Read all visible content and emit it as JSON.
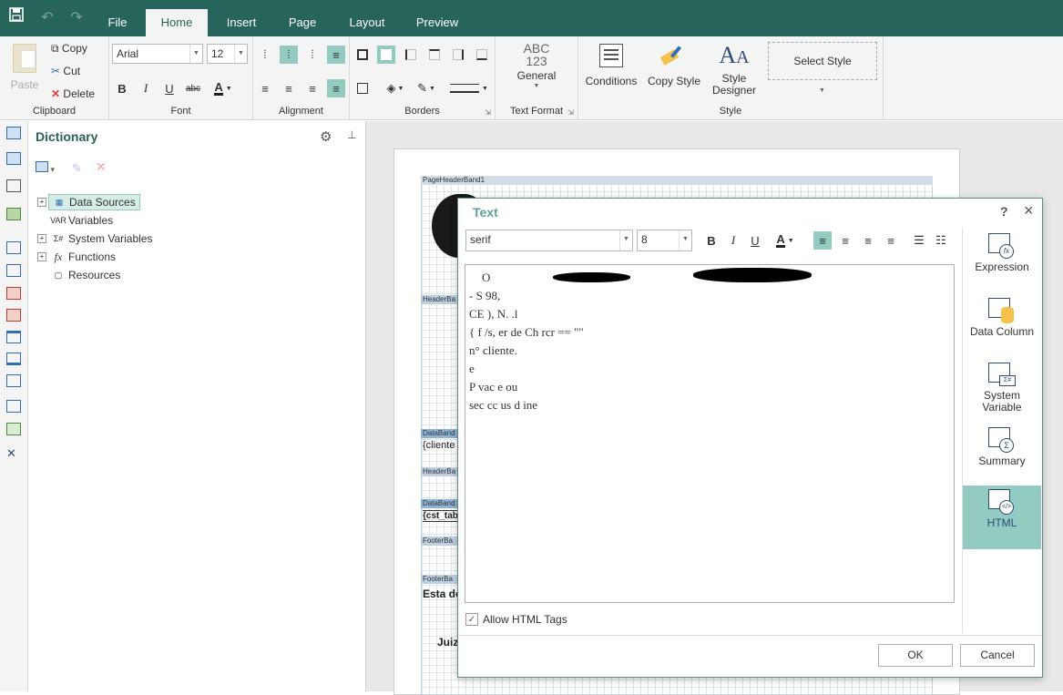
{
  "tabs": [
    "File",
    "Home",
    "Insert",
    "Page",
    "Layout",
    "Preview"
  ],
  "active_tab": "Home",
  "clipboard": {
    "paste": "Paste",
    "copy": "Copy",
    "cut": "Cut",
    "delete": "Delete",
    "label": "Clipboard"
  },
  "font": {
    "family": "Arial",
    "size": "12",
    "label": "Font",
    "bold": "B",
    "italic": "I",
    "underline": "U",
    "strike": "abc",
    "color": "A"
  },
  "alignment": {
    "label": "Alignment"
  },
  "borders": {
    "label": "Borders"
  },
  "text_format": {
    "abc": "ABC",
    "num": "123",
    "general": "General",
    "label": "Text Format"
  },
  "style": {
    "conditions": "Conditions",
    "copy_style": "Copy Style",
    "style_designer": "Style Designer",
    "select_style": "Select Style",
    "label": "Style"
  },
  "dictionary": {
    "title": "Dictionary",
    "items": [
      {
        "label": "Data Sources",
        "expandable": true,
        "selected": true
      },
      {
        "label": "Variables",
        "expandable": false
      },
      {
        "label": "System Variables",
        "expandable": true
      },
      {
        "label": "Functions",
        "expandable": true
      },
      {
        "label": "Resources",
        "expandable": false
      }
    ]
  },
  "report": {
    "bands": [
      {
        "label": "PageHeaderBand1",
        "wide": true
      },
      {
        "label": "HeaderBa"
      },
      {
        "label": "DataBand"
      },
      {
        "label": "HeaderBa"
      },
      {
        "label": "DataBand"
      },
      {
        "label": "FooterBa"
      },
      {
        "label": "FooterBa"
      }
    ],
    "texts": [
      "{cliente",
      "{cst_tab",
      "Esta de",
      "Juiz"
    ]
  },
  "dialog": {
    "title": "Text",
    "help": "?",
    "close": "×",
    "font_family": "serif",
    "font_size": "8",
    "editor_lines": [
      "O",
      "- S                                                                              98,",
      "CE            ), N.                              .l",
      "{ f      /s,     er     de       Ch                                   rcr == \"\"",
      "n°      cliente.",
      "                                                            e",
      "P                     vac                            e                             ou",
      "sec     cc                 us d  ine"
    ],
    "allow_html_label": "Allow HTML Tags",
    "allow_html_checked": true,
    "side_buttons": [
      {
        "label": "Expression",
        "icon": "expression-icon"
      },
      {
        "label": "Data Column",
        "icon": "data-column-icon"
      },
      {
        "label": "System Variable",
        "icon": "system-variable-icon"
      },
      {
        "label": "Summary",
        "icon": "summary-icon"
      },
      {
        "label": "HTML",
        "icon": "html-icon",
        "active": true
      }
    ],
    "ok": "OK",
    "cancel": "Cancel"
  },
  "colors": {
    "brand": "#276459",
    "accent": "#93cbc0",
    "title_accent": "#5ba396"
  }
}
